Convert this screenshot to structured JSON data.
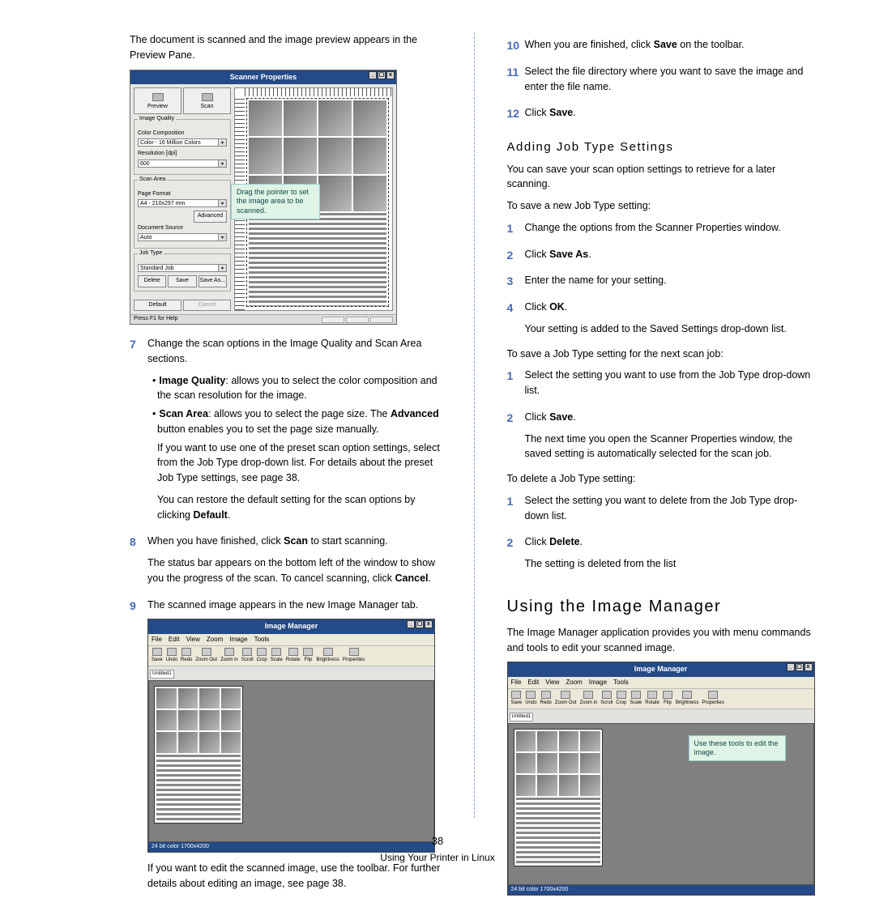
{
  "intro_left": "The document is scanned and the image preview appears in the Preview Pane.",
  "scanner_window": {
    "title": "Scanner Properties",
    "win_btn_min": "_",
    "win_btn_max": "▢",
    "win_btn_close": "x",
    "preview_btn": "Preview",
    "scan_btn": "Scan",
    "group_image_quality": "Image Quality",
    "label_color_comp": "Color Composition",
    "color_comp_value": "Color - 16 Million Colors",
    "label_resolution": "Resolution [dpi]",
    "resolution_value": "600",
    "group_scan_area": "Scan Area",
    "label_page_format": "Page Format",
    "page_format_value": "A4 - 210x297 mm",
    "advanced_btn": "Advanced",
    "label_document_source": "Document Source",
    "document_source_value": "Auto",
    "group_job_type": "Job Type",
    "job_type_value": "Standard Job",
    "delete_btn": "Delete",
    "save_btn": "Save",
    "saveas_btn": "Save As...",
    "default_btn": "Default",
    "cancel_btn": "Cancel",
    "statusbar_text": "Press F1 for Help",
    "callout": "Drag the pointer to set the image area to be scanned.",
    "dropdown_arrow": "▾"
  },
  "step7_text": "Change the scan options in the Image Quality and Scan Area sections.",
  "bullet_iq_label": "Image Quality",
  "bullet_iq_rest": ": allows you to select the color composition and the scan resolution for the image.",
  "bullet_sa_label": "Scan Area",
  "bullet_sa_rest": ": allows you to select the page size. The ",
  "bullet_sa_adv": "Advanced",
  "bullet_sa_rest2": " button enables you to set the page size manually.",
  "iq_para1": "If you want to use one of the preset scan option settings, select from the Job Type drop-down list. For details about the preset Job Type settings, see page 38.",
  "iq_para2a": "You can restore the default setting for the scan options by clicking ",
  "iq_para2b": "Default",
  "iq_para2c": ".",
  "step8a": "When you have finished, click ",
  "step8b": "Scan",
  "step8c": " to start scanning.",
  "step8_p1": "The status bar appears on the bottom left of the window to show you the progress of the scan. To cancel scanning, click ",
  "step8_cancel": "Cancel",
  "step8_p1b": ".",
  "step9": "The scanned image appears in the new Image Manager tab.",
  "im_window": {
    "title": "Image Manager",
    "menu_file": "File",
    "menu_edit": "Edit",
    "menu_view": "View",
    "menu_zoom": "Zoom",
    "menu_image": "Image",
    "menu_tools": "Tools",
    "tb_save": "Save",
    "tb_undo": "Undo",
    "tb_redo": "Redo",
    "tb_zoomout": "Zoom Out",
    "tb_zoomin": "Zoom in",
    "tb_scroll": "Scroll",
    "tb_crop": "Crop",
    "tb_scale": "Scale",
    "tb_rotate": "Rotate",
    "tb_flip": "Flip",
    "tb_brightness": "Brightness",
    "tb_properties": "Properties",
    "tab_label": "Untitled1",
    "status_text": "24 bit color 1700x4200",
    "callout": "Use these tools to edit the image."
  },
  "left_bottom_para": "If you want to edit the scanned image, use the toolbar. For further details about editing an image, see page 38.",
  "step10a": "When you are finished, click ",
  "step10b": "Save",
  "step10c": " on the toolbar.",
  "step11": "Select the file directory where you want to save the image and enter the file name.",
  "step12a": "Click ",
  "step12b": "Save",
  "step12c": ".",
  "adding_heading": "Adding Job Type Settings",
  "adding_intro": "You can save your scan option settings to retrieve for a later scanning.",
  "adding_save_new": "To save a new Job Type setting:",
  "a1": "Change the options from the Scanner Properties window.",
  "a2a": "Click ",
  "a2b": "Save As",
  "a2c": ".",
  "a3": "Enter the name for your setting.",
  "a4a": "Click ",
  "a4b": "OK",
  "a4c": ".",
  "a4_note": "Your setting is added to the Saved Settings drop-down list.",
  "adding_save_next": "To save a Job Type setting for the next scan job:",
  "n1": "Select the setting you want to use from the Job Type drop-down list.",
  "n2a": "Click ",
  "n2b": "Save",
  "n2c": ".",
  "n2_note": "The next time you open the Scanner Properties window, the saved setting is automatically selected for the scan job.",
  "adding_delete": "To delete a Job Type setting:",
  "d1": "Select the setting you want to delete from the Job Type drop-down list.",
  "d2a": "Click ",
  "d2b": "Delete",
  "d2c": ".",
  "d2_note": "The setting is deleted from the list",
  "using_heading": "Using the Image Manager",
  "using_intro": "The Image Manager application provides you with menu commands and tools to edit your scanned image.",
  "page_number": "38",
  "page_footer": "Using Your Printer in Linux",
  "nums": {
    "n1": "1",
    "n2": "2",
    "n3": "3",
    "n4": "4",
    "n7": "7",
    "n8": "8",
    "n9": "9",
    "n10": "10",
    "n11": "11",
    "n12": "12"
  }
}
